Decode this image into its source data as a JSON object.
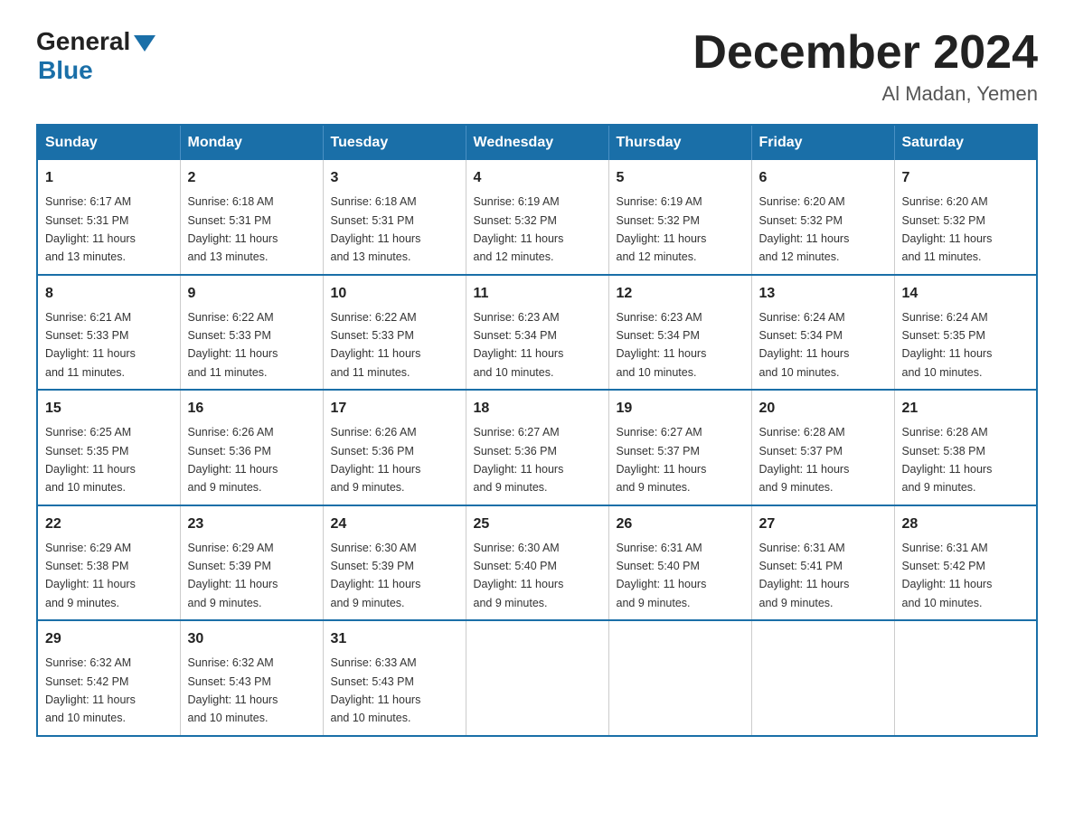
{
  "logo": {
    "general": "General",
    "blue": "Blue"
  },
  "title": {
    "month": "December 2024",
    "location": "Al Madan, Yemen"
  },
  "weekdays": [
    "Sunday",
    "Monday",
    "Tuesday",
    "Wednesday",
    "Thursday",
    "Friday",
    "Saturday"
  ],
  "weeks": [
    [
      {
        "day": "1",
        "sunrise": "6:17 AM",
        "sunset": "5:31 PM",
        "daylight": "11 hours and 13 minutes."
      },
      {
        "day": "2",
        "sunrise": "6:18 AM",
        "sunset": "5:31 PM",
        "daylight": "11 hours and 13 minutes."
      },
      {
        "day": "3",
        "sunrise": "6:18 AM",
        "sunset": "5:31 PM",
        "daylight": "11 hours and 13 minutes."
      },
      {
        "day": "4",
        "sunrise": "6:19 AM",
        "sunset": "5:32 PM",
        "daylight": "11 hours and 12 minutes."
      },
      {
        "day": "5",
        "sunrise": "6:19 AM",
        "sunset": "5:32 PM",
        "daylight": "11 hours and 12 minutes."
      },
      {
        "day": "6",
        "sunrise": "6:20 AM",
        "sunset": "5:32 PM",
        "daylight": "11 hours and 12 minutes."
      },
      {
        "day": "7",
        "sunrise": "6:20 AM",
        "sunset": "5:32 PM",
        "daylight": "11 hours and 11 minutes."
      }
    ],
    [
      {
        "day": "8",
        "sunrise": "6:21 AM",
        "sunset": "5:33 PM",
        "daylight": "11 hours and 11 minutes."
      },
      {
        "day": "9",
        "sunrise": "6:22 AM",
        "sunset": "5:33 PM",
        "daylight": "11 hours and 11 minutes."
      },
      {
        "day": "10",
        "sunrise": "6:22 AM",
        "sunset": "5:33 PM",
        "daylight": "11 hours and 11 minutes."
      },
      {
        "day": "11",
        "sunrise": "6:23 AM",
        "sunset": "5:34 PM",
        "daylight": "11 hours and 10 minutes."
      },
      {
        "day": "12",
        "sunrise": "6:23 AM",
        "sunset": "5:34 PM",
        "daylight": "11 hours and 10 minutes."
      },
      {
        "day": "13",
        "sunrise": "6:24 AM",
        "sunset": "5:34 PM",
        "daylight": "11 hours and 10 minutes."
      },
      {
        "day": "14",
        "sunrise": "6:24 AM",
        "sunset": "5:35 PM",
        "daylight": "11 hours and 10 minutes."
      }
    ],
    [
      {
        "day": "15",
        "sunrise": "6:25 AM",
        "sunset": "5:35 PM",
        "daylight": "11 hours and 10 minutes."
      },
      {
        "day": "16",
        "sunrise": "6:26 AM",
        "sunset": "5:36 PM",
        "daylight": "11 hours and 9 minutes."
      },
      {
        "day": "17",
        "sunrise": "6:26 AM",
        "sunset": "5:36 PM",
        "daylight": "11 hours and 9 minutes."
      },
      {
        "day": "18",
        "sunrise": "6:27 AM",
        "sunset": "5:36 PM",
        "daylight": "11 hours and 9 minutes."
      },
      {
        "day": "19",
        "sunrise": "6:27 AM",
        "sunset": "5:37 PM",
        "daylight": "11 hours and 9 minutes."
      },
      {
        "day": "20",
        "sunrise": "6:28 AM",
        "sunset": "5:37 PM",
        "daylight": "11 hours and 9 minutes."
      },
      {
        "day": "21",
        "sunrise": "6:28 AM",
        "sunset": "5:38 PM",
        "daylight": "11 hours and 9 minutes."
      }
    ],
    [
      {
        "day": "22",
        "sunrise": "6:29 AM",
        "sunset": "5:38 PM",
        "daylight": "11 hours and 9 minutes."
      },
      {
        "day": "23",
        "sunrise": "6:29 AM",
        "sunset": "5:39 PM",
        "daylight": "11 hours and 9 minutes."
      },
      {
        "day": "24",
        "sunrise": "6:30 AM",
        "sunset": "5:39 PM",
        "daylight": "11 hours and 9 minutes."
      },
      {
        "day": "25",
        "sunrise": "6:30 AM",
        "sunset": "5:40 PM",
        "daylight": "11 hours and 9 minutes."
      },
      {
        "day": "26",
        "sunrise": "6:31 AM",
        "sunset": "5:40 PM",
        "daylight": "11 hours and 9 minutes."
      },
      {
        "day": "27",
        "sunrise": "6:31 AM",
        "sunset": "5:41 PM",
        "daylight": "11 hours and 9 minutes."
      },
      {
        "day": "28",
        "sunrise": "6:31 AM",
        "sunset": "5:42 PM",
        "daylight": "11 hours and 10 minutes."
      }
    ],
    [
      {
        "day": "29",
        "sunrise": "6:32 AM",
        "sunset": "5:42 PM",
        "daylight": "11 hours and 10 minutes."
      },
      {
        "day": "30",
        "sunrise": "6:32 AM",
        "sunset": "5:43 PM",
        "daylight": "11 hours and 10 minutes."
      },
      {
        "day": "31",
        "sunrise": "6:33 AM",
        "sunset": "5:43 PM",
        "daylight": "11 hours and 10 minutes."
      },
      null,
      null,
      null,
      null
    ]
  ],
  "labels": {
    "sunrise": "Sunrise: ",
    "sunset": "Sunset: ",
    "daylight": "Daylight: "
  }
}
